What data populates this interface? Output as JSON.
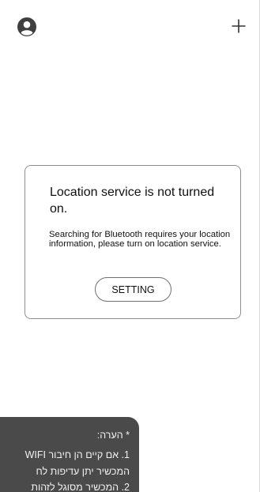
{
  "header": {
    "profile_icon": "user-avatar-icon",
    "add_icon": "plus-icon"
  },
  "dialog": {
    "title": "Location service is not turned on.",
    "message": "Searching for Bluetooth requires your location information, please turn on location service.",
    "setting_button": "SETTING"
  },
  "note": {
    "heading": "* הערה:",
    "line1": "1. אם קיים הן חיבור WIFI",
    "line2": "המכשיר יתן עדיפות לח",
    "line3": "2. המכשיר מסוגל לזהות"
  },
  "colors": {
    "background": "#ffffff",
    "dialog_border": "#8e8e8e",
    "note_background": "#4a4a4a",
    "note_text": "#f2f2f2"
  }
}
